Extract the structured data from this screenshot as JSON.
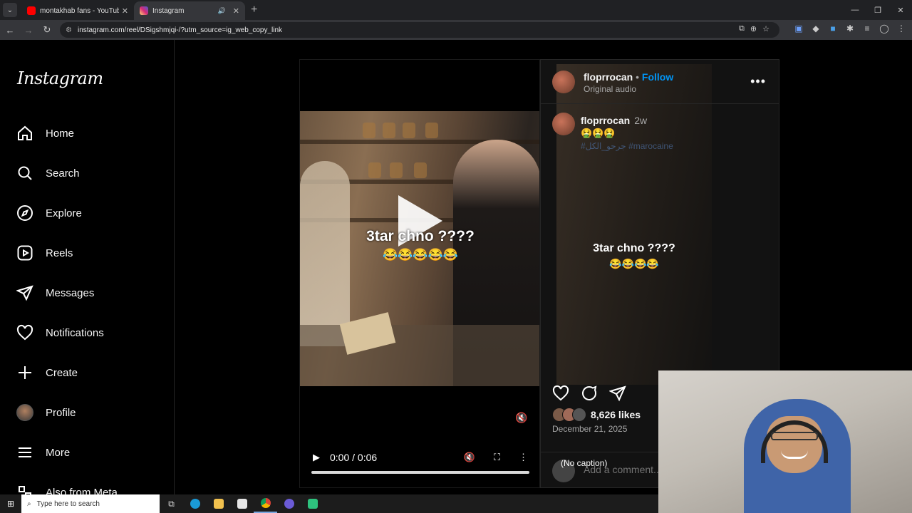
{
  "browser": {
    "tabs": [
      {
        "title": "montakhab fans - YouTube",
        "active": false,
        "favicon_color": "#ff0000"
      },
      {
        "title": "Instagram",
        "active": true,
        "favicon_color": "#d62976"
      }
    ],
    "url": "instagram.com/reel/DSigshmjqi-/?utm_source=ig_web_copy_link"
  },
  "sidebar": {
    "logo": "Instagram",
    "items": [
      {
        "label": "Home",
        "icon": "home-icon"
      },
      {
        "label": "Search",
        "icon": "search-icon"
      },
      {
        "label": "Explore",
        "icon": "compass-icon"
      },
      {
        "label": "Reels",
        "icon": "reels-icon"
      },
      {
        "label": "Messages",
        "icon": "send-icon"
      },
      {
        "label": "Notifications",
        "icon": "heart-icon"
      },
      {
        "label": "Create",
        "icon": "plus-icon"
      },
      {
        "label": "Profile",
        "icon": "avatar"
      },
      {
        "label": "More",
        "icon": "menu-icon"
      },
      {
        "label": "Also from Meta",
        "icon": "meta-icon"
      }
    ]
  },
  "video": {
    "caption_text": "3tar chno ????",
    "caption_emoji": "😂😂😂😂😂",
    "time": "0:00 / 0:06",
    "progress": 0
  },
  "post": {
    "username": "floprrocan",
    "follow_label": "Follow",
    "audio": "Original audio",
    "comment_user": "floprrocan",
    "comment_time": "2w",
    "comment_emoji": "🤮🤮🤮",
    "hashtags": "#جرحو_الكل #marocaine",
    "ghost_caption": "3tar chno ????",
    "ghost_emoji": "😂😂😂😂",
    "likes": "8,626 likes",
    "date": "December 21, 2025",
    "no_caption": "(No caption)",
    "add_comment_placeholder": "Add a comment..."
  },
  "taskbar": {
    "search_placeholder": "Type here to search"
  },
  "colors": {
    "accent": "#0095f6",
    "background": "#000000",
    "panel": "#121212"
  }
}
